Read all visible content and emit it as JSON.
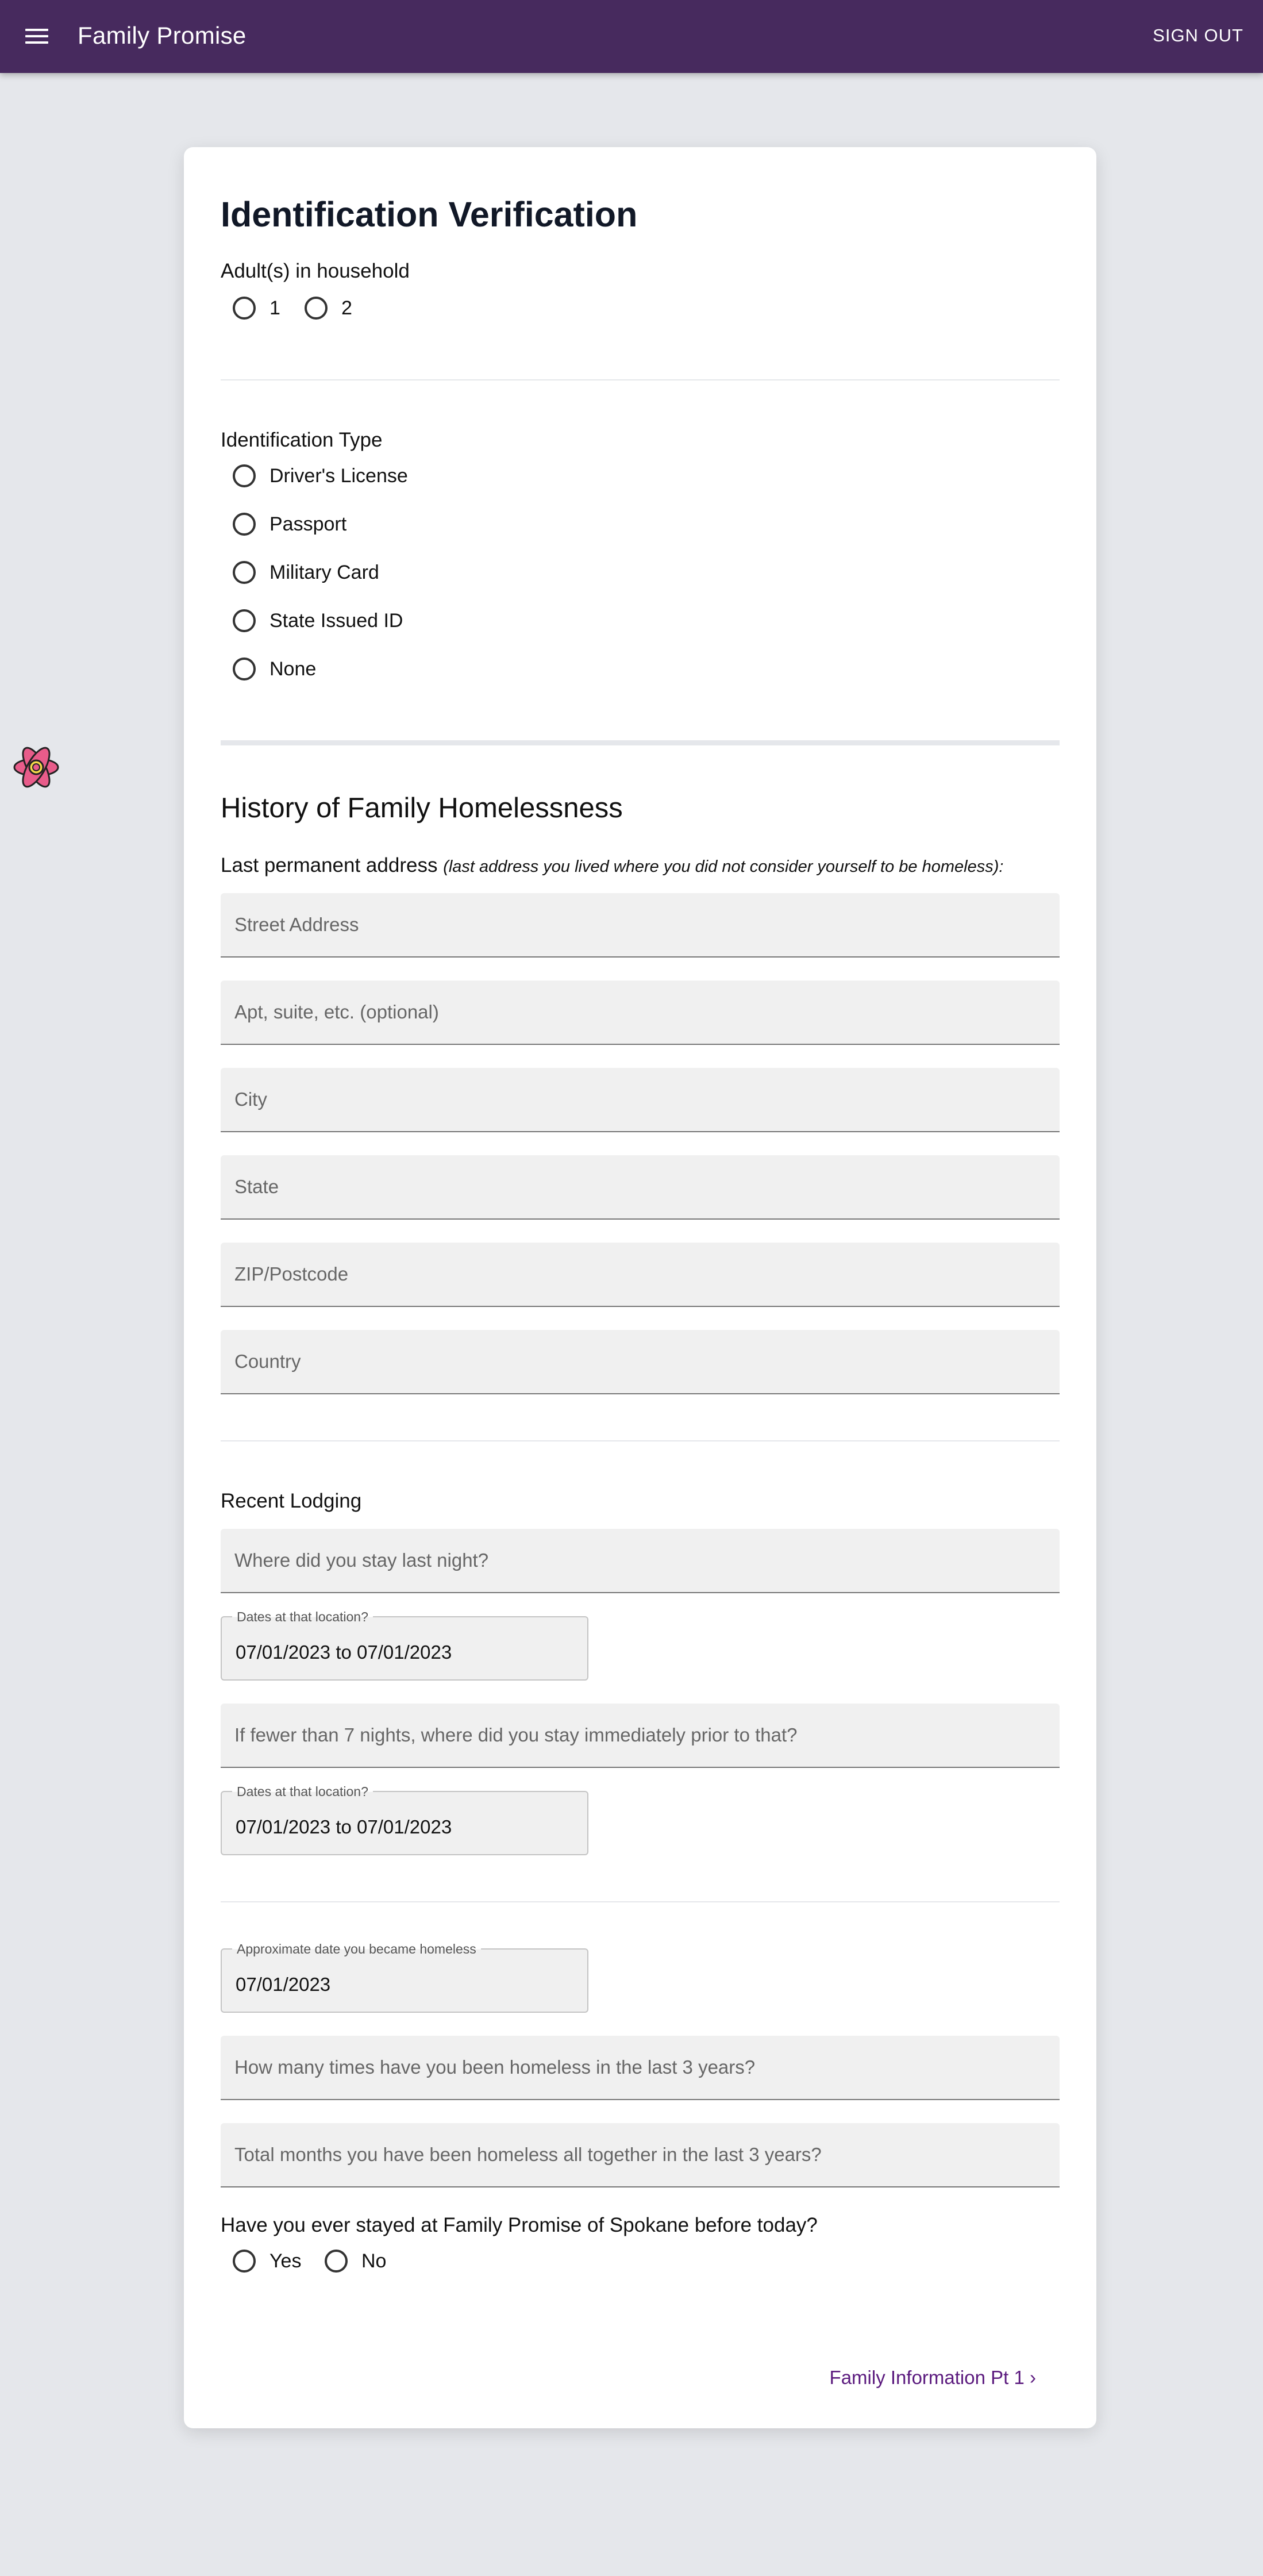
{
  "header": {
    "brand": "Family Promise",
    "signout_label": "SIGN OUT",
    "bar_color": "#472a5e"
  },
  "form": {
    "title": "Identification Verification",
    "adults": {
      "label": "Adult(s) in household",
      "options": [
        "1",
        "2"
      ]
    },
    "id_type": {
      "label": "Identification Type",
      "options": [
        "Driver's License",
        "Passport",
        "Military Card",
        "State Issued ID",
        "None"
      ]
    },
    "history": {
      "title": "History of Family Homelessness",
      "address_label": "Last permanent address",
      "address_note": "(last address you lived where you did not consider yourself to be homeless):",
      "street_placeholder": "Street Address",
      "apt_placeholder": "Apt, suite, etc. (optional)",
      "city_placeholder": "City",
      "state_placeholder": "State",
      "zip_placeholder": "ZIP/Postcode",
      "country_placeholder": "Country"
    },
    "lodging": {
      "label": "Recent Lodging",
      "last_night_placeholder": "Where did you stay last night?",
      "dates_label": "Dates at that location?",
      "dates_value": "07/01/2023 to 07/01/2023",
      "prior_placeholder": "If fewer than 7 nights, where did you stay immediately prior to that?",
      "dates2_label": "Dates at that location?",
      "dates2_value": "07/01/2023 to 07/01/2023"
    },
    "homeless": {
      "date_label": "Approximate date you became homeless",
      "date_value": "07/01/2023",
      "times_placeholder": "How many times have you been homeless in the last 3 years?",
      "months_placeholder": "Total months you have been homeless all together in the last 3 years?",
      "stayed_question": "Have you ever stayed at Family Promise of Spokane before today?",
      "stayed_options": [
        "Yes",
        "No"
      ]
    },
    "next_link": "Family Information Pt 1 ›"
  }
}
